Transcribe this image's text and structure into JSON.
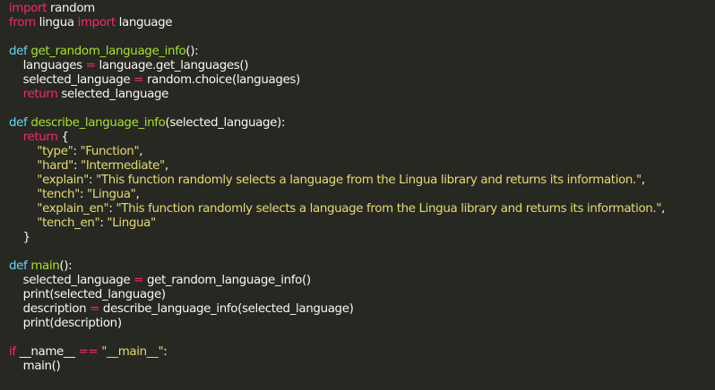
{
  "code": {
    "language": "python",
    "lines": [
      [
        {
          "t": "import",
          "c": "kw"
        },
        {
          "t": " random",
          "c": "pl"
        }
      ],
      [
        {
          "t": "from",
          "c": "kw"
        },
        {
          "t": " lingua ",
          "c": "pl"
        },
        {
          "t": "import",
          "c": "kw"
        },
        {
          "t": " language",
          "c": "pl"
        }
      ],
      [],
      [
        {
          "t": "def",
          "c": "def"
        },
        {
          "t": " ",
          "c": "pl"
        },
        {
          "t": "get_random_language_info",
          "c": "fn"
        },
        {
          "t": "():",
          "c": "pl"
        }
      ],
      [
        {
          "t": "    languages ",
          "c": "pl"
        },
        {
          "t": "=",
          "c": "op"
        },
        {
          "t": " language.get_languages()",
          "c": "pl"
        }
      ],
      [
        {
          "t": "    selected_language ",
          "c": "pl"
        },
        {
          "t": "=",
          "c": "op"
        },
        {
          "t": " random.choice(languages)",
          "c": "pl"
        }
      ],
      [
        {
          "t": "    ",
          "c": "pl"
        },
        {
          "t": "return",
          "c": "kw"
        },
        {
          "t": " selected_language",
          "c": "pl"
        }
      ],
      [],
      [
        {
          "t": "def",
          "c": "def"
        },
        {
          "t": " ",
          "c": "pl"
        },
        {
          "t": "describe_language_info",
          "c": "fn"
        },
        {
          "t": "(selected_language):",
          "c": "pl"
        }
      ],
      [
        {
          "t": "    ",
          "c": "pl"
        },
        {
          "t": "return",
          "c": "kw"
        },
        {
          "t": " {",
          "c": "pl"
        }
      ],
      [
        {
          "t": "        ",
          "c": "pl"
        },
        {
          "t": "\"type\"",
          "c": "str"
        },
        {
          "t": ": ",
          "c": "pl"
        },
        {
          "t": "\"Function\"",
          "c": "str"
        },
        {
          "t": ",",
          "c": "pl"
        }
      ],
      [
        {
          "t": "        ",
          "c": "pl"
        },
        {
          "t": "\"hard\"",
          "c": "str"
        },
        {
          "t": ": ",
          "c": "pl"
        },
        {
          "t": "\"Intermediate\"",
          "c": "str"
        },
        {
          "t": ",",
          "c": "pl"
        }
      ],
      [
        {
          "t": "        ",
          "c": "pl"
        },
        {
          "t": "\"explain\"",
          "c": "str"
        },
        {
          "t": ": ",
          "c": "pl"
        },
        {
          "t": "\"This function randomly selects a language from the Lingua library and returns its information.\"",
          "c": "str"
        },
        {
          "t": ",",
          "c": "pl"
        }
      ],
      [
        {
          "t": "        ",
          "c": "pl"
        },
        {
          "t": "\"tench\"",
          "c": "str"
        },
        {
          "t": ": ",
          "c": "pl"
        },
        {
          "t": "\"Lingua\"",
          "c": "str"
        },
        {
          "t": ",",
          "c": "pl"
        }
      ],
      [
        {
          "t": "        ",
          "c": "pl"
        },
        {
          "t": "\"explain_en\"",
          "c": "str"
        },
        {
          "t": ": ",
          "c": "pl"
        },
        {
          "t": "\"This function randomly selects a language from the Lingua library and returns its information.\"",
          "c": "str"
        },
        {
          "t": ",",
          "c": "pl"
        }
      ],
      [
        {
          "t": "        ",
          "c": "pl"
        },
        {
          "t": "\"tench_en\"",
          "c": "str"
        },
        {
          "t": ": ",
          "c": "pl"
        },
        {
          "t": "\"Lingua\"",
          "c": "str"
        }
      ],
      [
        {
          "t": "    }",
          "c": "pl"
        }
      ],
      [],
      [
        {
          "t": "def",
          "c": "def"
        },
        {
          "t": " ",
          "c": "pl"
        },
        {
          "t": "main",
          "c": "fn"
        },
        {
          "t": "():",
          "c": "pl"
        }
      ],
      [
        {
          "t": "    selected_language ",
          "c": "pl"
        },
        {
          "t": "=",
          "c": "op"
        },
        {
          "t": " get_random_language_info()",
          "c": "pl"
        }
      ],
      [
        {
          "t": "    print(selected_language)",
          "c": "pl"
        }
      ],
      [
        {
          "t": "    description ",
          "c": "pl"
        },
        {
          "t": "=",
          "c": "op"
        },
        {
          "t": " describe_language_info(selected_language)",
          "c": "pl"
        }
      ],
      [
        {
          "t": "    print(description)",
          "c": "pl"
        }
      ],
      [],
      [
        {
          "t": "if",
          "c": "kw"
        },
        {
          "t": " __name__ ",
          "c": "pl"
        },
        {
          "t": "==",
          "c": "op"
        },
        {
          "t": " ",
          "c": "pl"
        },
        {
          "t": "\"__main__\"",
          "c": "str"
        },
        {
          "t": ":",
          "c": "pl"
        }
      ],
      [
        {
          "t": "    main()",
          "c": "pl"
        }
      ]
    ]
  },
  "colors": {
    "background": "#272822",
    "keyword": "#f92672",
    "def": "#66d9ef",
    "function": "#a6e22e",
    "string": "#e6db74",
    "plain": "#f8f8f2"
  }
}
